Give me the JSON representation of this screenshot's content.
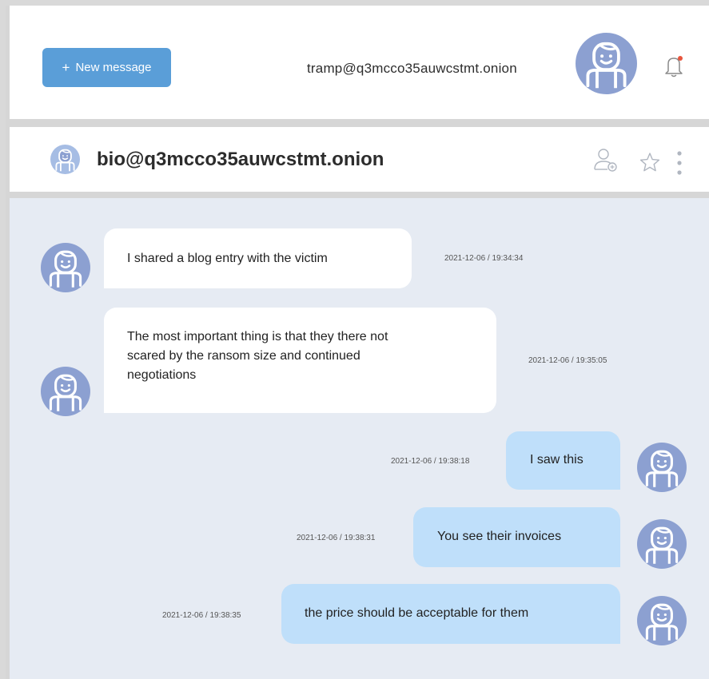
{
  "topbar": {
    "new_message_label": "New message",
    "new_message_icon": "plus-icon",
    "user_email": "tramp@q3mcco35auwcstmt.onion",
    "notification_icon": "bell-icon",
    "notification_dot_color": "#e8553d"
  },
  "chat": {
    "contact_name": "bio@q3mcco35auwcstmt.onion",
    "actions": [
      "add-contact-icon",
      "star-icon",
      "more-vertical-icon"
    ]
  },
  "colors": {
    "accent": "#5a9ed8",
    "avatar_bg": "#8ca0d1",
    "incoming_bubble": "#ffffff",
    "outgoing_bubble": "#bfdffa",
    "chat_bg": "#e6ebf3"
  },
  "messages": [
    {
      "direction": "incoming",
      "text": "I shared a blog entry with the victim",
      "timestamp": "2021-12-06 / 19:34:34"
    },
    {
      "direction": "incoming",
      "lines": [
        "The most important thing is that they there not",
        "scared by the ransom size and continued",
        "negotiations"
      ],
      "timestamp": "2021-12-06 / 19:35:05"
    },
    {
      "direction": "outgoing",
      "text": "I saw this",
      "timestamp": "2021-12-06 / 19:38:18"
    },
    {
      "direction": "outgoing",
      "text": "You see their invoices",
      "timestamp": "2021-12-06 / 19:38:31"
    },
    {
      "direction": "outgoing",
      "text": "the price should be acceptable for them",
      "timestamp": "2021-12-06 / 19:38:35"
    }
  ]
}
